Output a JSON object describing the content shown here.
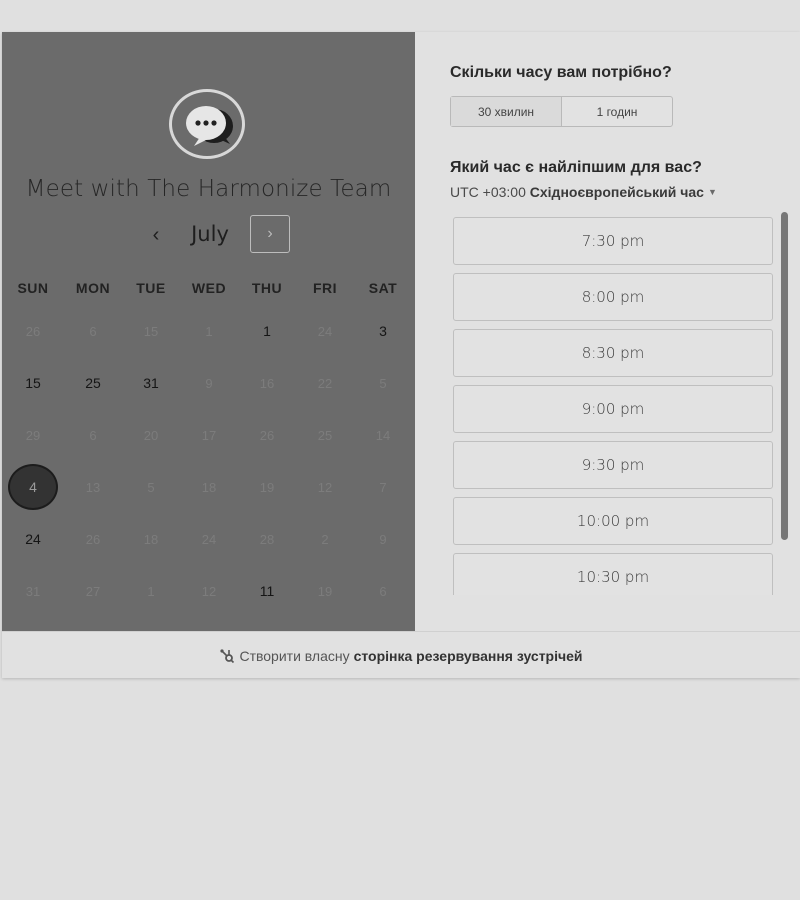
{
  "left": {
    "title": "Meet with The Harmonize Team",
    "month": "July",
    "prev_icon": "chevron-left-icon",
    "next_icon": "chevron-right-icon",
    "weekdays": [
      "SUN",
      "MON",
      "TUE",
      "WED",
      "THU",
      "FRI",
      "SAT"
    ],
    "weeks": [
      [
        {
          "d": "26",
          "a": false
        },
        {
          "d": "6",
          "a": false
        },
        {
          "d": "15",
          "a": false
        },
        {
          "d": "1",
          "a": false
        },
        {
          "d": "1",
          "a": true
        },
        {
          "d": "24",
          "a": false
        },
        {
          "d": "3",
          "a": true
        }
      ],
      [
        {
          "d": "15",
          "a": true
        },
        {
          "d": "25",
          "a": true
        },
        {
          "d": "31",
          "a": true
        },
        {
          "d": "9",
          "a": false
        },
        {
          "d": "16",
          "a": false
        },
        {
          "d": "22",
          "a": false
        },
        {
          "d": "5",
          "a": false
        }
      ],
      [
        {
          "d": "29",
          "a": false
        },
        {
          "d": "6",
          "a": false
        },
        {
          "d": "20",
          "a": false
        },
        {
          "d": "17",
          "a": false
        },
        {
          "d": "26",
          "a": false
        },
        {
          "d": "25",
          "a": false
        },
        {
          "d": "14",
          "a": false
        }
      ],
      [
        {
          "d": "4",
          "a": true,
          "s": true
        },
        {
          "d": "13",
          "a": false
        },
        {
          "d": "5",
          "a": false
        },
        {
          "d": "18",
          "a": false
        },
        {
          "d": "19",
          "a": false
        },
        {
          "d": "12",
          "a": false
        },
        {
          "d": "7",
          "a": false
        }
      ],
      [
        {
          "d": "24",
          "a": true
        },
        {
          "d": "26",
          "a": false
        },
        {
          "d": "18",
          "a": false
        },
        {
          "d": "24",
          "a": false
        },
        {
          "d": "28",
          "a": false
        },
        {
          "d": "2",
          "a": false
        },
        {
          "d": "9",
          "a": false
        }
      ],
      [
        {
          "d": "31",
          "a": false
        },
        {
          "d": "27",
          "a": false
        },
        {
          "d": "1",
          "a": false
        },
        {
          "d": "12",
          "a": false
        },
        {
          "d": "11",
          "a": true
        },
        {
          "d": "19",
          "a": false
        },
        {
          "d": "6",
          "a": false
        }
      ]
    ]
  },
  "right": {
    "duration_question": "Скільки часу вам потрібно?",
    "durations": [
      "30 хвилин",
      "1 годин"
    ],
    "time_question": "Який час є найліпшим для вас?",
    "tz_offset": "UTC +03:00",
    "tz_name": "Східноєвропейський час",
    "slots": [
      "7:30 pm",
      "8:00 pm",
      "8:30 pm",
      "9:00 pm",
      "9:30 pm",
      "10:00 pm",
      "10:30 pm"
    ]
  },
  "footer": {
    "icon": "hubspot-sprocket-icon",
    "text_plain": "Створити власну",
    "text_bold": "сторінка резервування зустрічей"
  }
}
